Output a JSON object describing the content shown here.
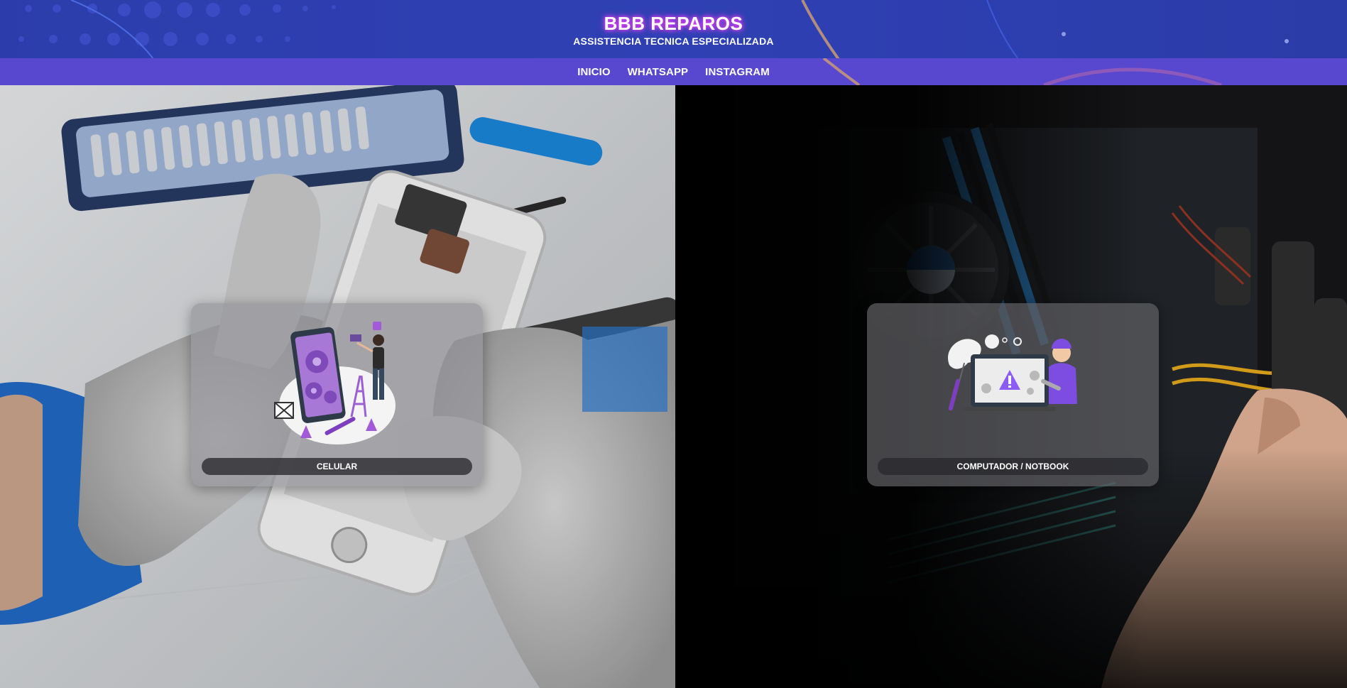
{
  "header": {
    "brand": "BBB REPAROS",
    "tagline": "ASSISTENCIA TECNICA ESPECIALIZADA"
  },
  "nav": {
    "items": [
      {
        "label": "INICIO"
      },
      {
        "label": "WHATSAPP"
      },
      {
        "label": "INSTAGRAM"
      }
    ]
  },
  "services": [
    {
      "label": "CELULAR",
      "illustration": "phone-repair-illustration"
    },
    {
      "label": "COMPUTADOR / NOTBOOK",
      "illustration": "laptop-repair-illustration"
    }
  ],
  "colors": {
    "header_bg": "#2f40b4",
    "nav_bg": "#5848cf",
    "brand_glow": "#e040fb",
    "accent_purple": "#8b5cf6"
  }
}
